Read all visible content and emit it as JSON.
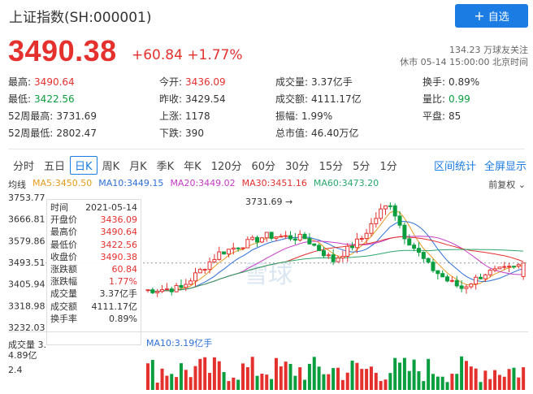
{
  "header": {
    "title": "上证指数(SH:000001)",
    "follow_label": "自选",
    "price": "3490.38",
    "change": "+60.84 +1.77%",
    "followers": "134.23 万球友关注",
    "market_time": "休市 05-14 15:00:00 北京时间"
  },
  "stats": [
    {
      "k": "最高:",
      "v": "3490.64",
      "c": "red"
    },
    {
      "k": "今开:",
      "v": "3436.09",
      "c": "red"
    },
    {
      "k": "成交量:",
      "v": "3.37亿手",
      "c": ""
    },
    {
      "k": "换手:",
      "v": "0.89%",
      "c": ""
    },
    {
      "k": "最低:",
      "v": "3422.56",
      "c": "green"
    },
    {
      "k": "昨收:",
      "v": "3429.54",
      "c": ""
    },
    {
      "k": "成交额:",
      "v": "4111.17亿",
      "c": ""
    },
    {
      "k": "量比:",
      "v": "0.99",
      "c": "green"
    },
    {
      "k": "52周最高:",
      "v": "3731.69",
      "c": ""
    },
    {
      "k": "上涨:",
      "v": "1178",
      "c": ""
    },
    {
      "k": "振幅:",
      "v": "1.99%",
      "c": ""
    },
    {
      "k": "平盘:",
      "v": "85",
      "c": ""
    },
    {
      "k": "52周最低:",
      "v": "2802.47",
      "c": ""
    },
    {
      "k": "下跌:",
      "v": "390",
      "c": ""
    },
    {
      "k": "总市值:",
      "v": "46.40万亿",
      "c": ""
    }
  ],
  "tabs": [
    "分时",
    "五日",
    "日K",
    "周K",
    "月K",
    "季K",
    "年K",
    "120分",
    "60分",
    "30分",
    "15分",
    "5分",
    "1分"
  ],
  "active_tab": "日K",
  "tools": [
    "区间统计",
    "全屏显示"
  ],
  "chart": {
    "indicator": "均线",
    "ma": {
      "ma5": "MA5:3450.50",
      "ma10": "MA10:3449.15",
      "ma20": "MA20:3449.02",
      "ma30": "MA30:3451.16",
      "ma60": "MA60:3473.20"
    },
    "fuquan": "前复权",
    "y_labels": [
      "3753.77",
      "3666.81",
      "3579.86",
      "3493.51",
      "3405.94",
      "3318.98",
      "3232.03"
    ],
    "high_marker": "3731.69",
    "watermark": "雪球",
    "colors": {
      "up": "#e4312e",
      "down": "#0a9e3f",
      "ma5": "#e59b1c",
      "ma10": "#2e6fd8",
      "ma20": "#c73ac7",
      "ma30": "#e4312e",
      "ma60": "#2aa86d"
    },
    "tooltip": [
      {
        "k": "时间",
        "v": "2021-05-14",
        "c": ""
      },
      {
        "k": "开盘价",
        "v": "3436.09",
        "c": "red"
      },
      {
        "k": "最高价",
        "v": "3490.64",
        "c": "red"
      },
      {
        "k": "最低价",
        "v": "3422.56",
        "c": "red"
      },
      {
        "k": "收盘价",
        "v": "3490.38",
        "c": "red"
      },
      {
        "k": "涨跌额",
        "v": "60.84",
        "c": "red"
      },
      {
        "k": "涨跌幅",
        "v": "1.77%",
        "c": "red"
      },
      {
        "k": "成交量",
        "v": "3.37亿手",
        "c": ""
      },
      {
        "k": "成交额",
        "v": "4111.17亿",
        "c": ""
      },
      {
        "k": "换手率",
        "v": "0.89%",
        "c": ""
      }
    ],
    "volume_head": "MA10:3.19亿手",
    "volume_labels": [
      "成交量 3.",
      "4.89亿",
      "2.4"
    ]
  }
}
